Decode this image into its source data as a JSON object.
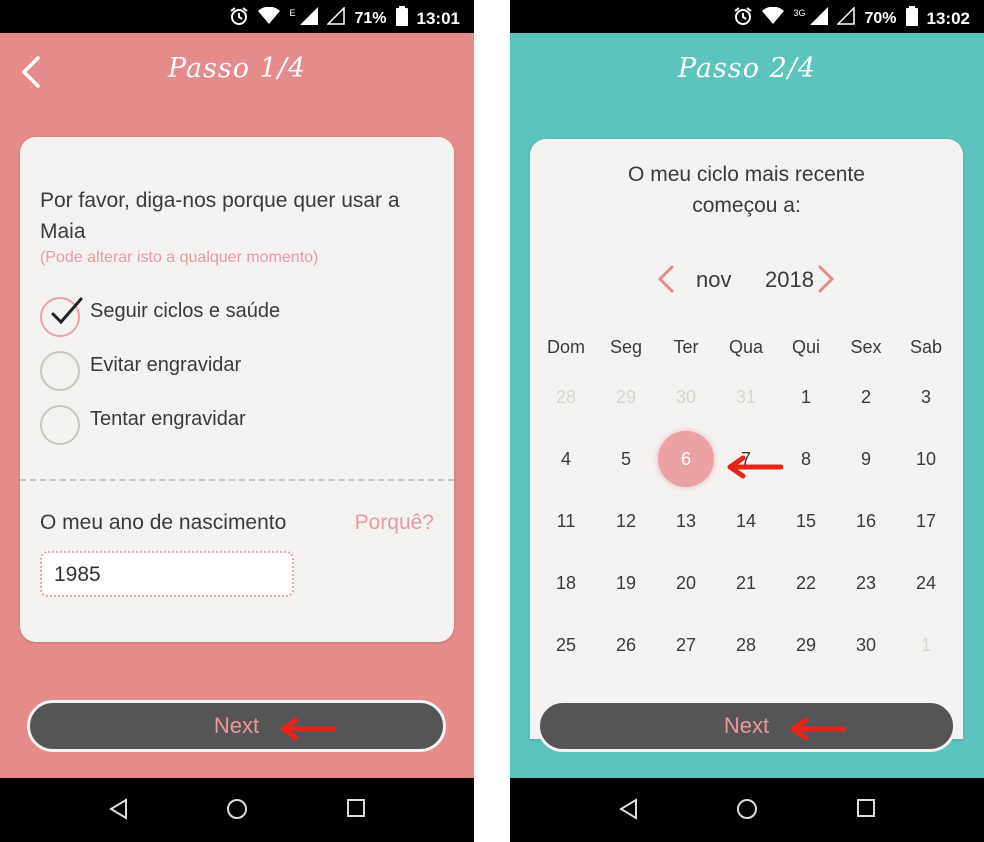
{
  "screen1": {
    "status": {
      "network": "E",
      "battery": "71%",
      "time": "13:01"
    },
    "title": "Passo 1/4",
    "question": "Por favor, diga-nos porque quer usar a Maia",
    "hint": "(Pode alterar isto a qualquer momento)",
    "options": [
      {
        "label": "Seguir ciclos e saúde",
        "selected": true
      },
      {
        "label": "Evitar engravidar",
        "selected": false
      },
      {
        "label": "Tentar engravidar",
        "selected": false
      }
    ],
    "birth_label": "O meu ano de nascimento",
    "why_link": "Porquê?",
    "birth_year": "1985",
    "next_label": "Next"
  },
  "screen2": {
    "status": {
      "network": "3G",
      "battery": "70%",
      "time": "13:02"
    },
    "title": "Passo 2/4",
    "question": "O meu ciclo mais recente começou a:",
    "month": "nov",
    "year": "2018",
    "weekdays": [
      "Dom",
      "Seg",
      "Ter",
      "Qua",
      "Qui",
      "Sex",
      "Sab"
    ],
    "weeks": [
      [
        "28",
        "29",
        "30",
        "31",
        "1",
        "2",
        "3"
      ],
      [
        "4",
        "5",
        "6",
        "7",
        "8",
        "9",
        "10"
      ],
      [
        "11",
        "12",
        "13",
        "14",
        "15",
        "16",
        "17"
      ],
      [
        "18",
        "19",
        "20",
        "21",
        "22",
        "23",
        "24"
      ],
      [
        "25",
        "26",
        "27",
        "28",
        "29",
        "30",
        "1"
      ]
    ],
    "selected_day": "6",
    "next_label": "Next"
  },
  "colors": {
    "screen1_bg": "#e58b8b",
    "screen2_bg": "#5cc3bd",
    "accent_pink": "#e99a9e",
    "annotation_arrow": "#e8241a"
  }
}
